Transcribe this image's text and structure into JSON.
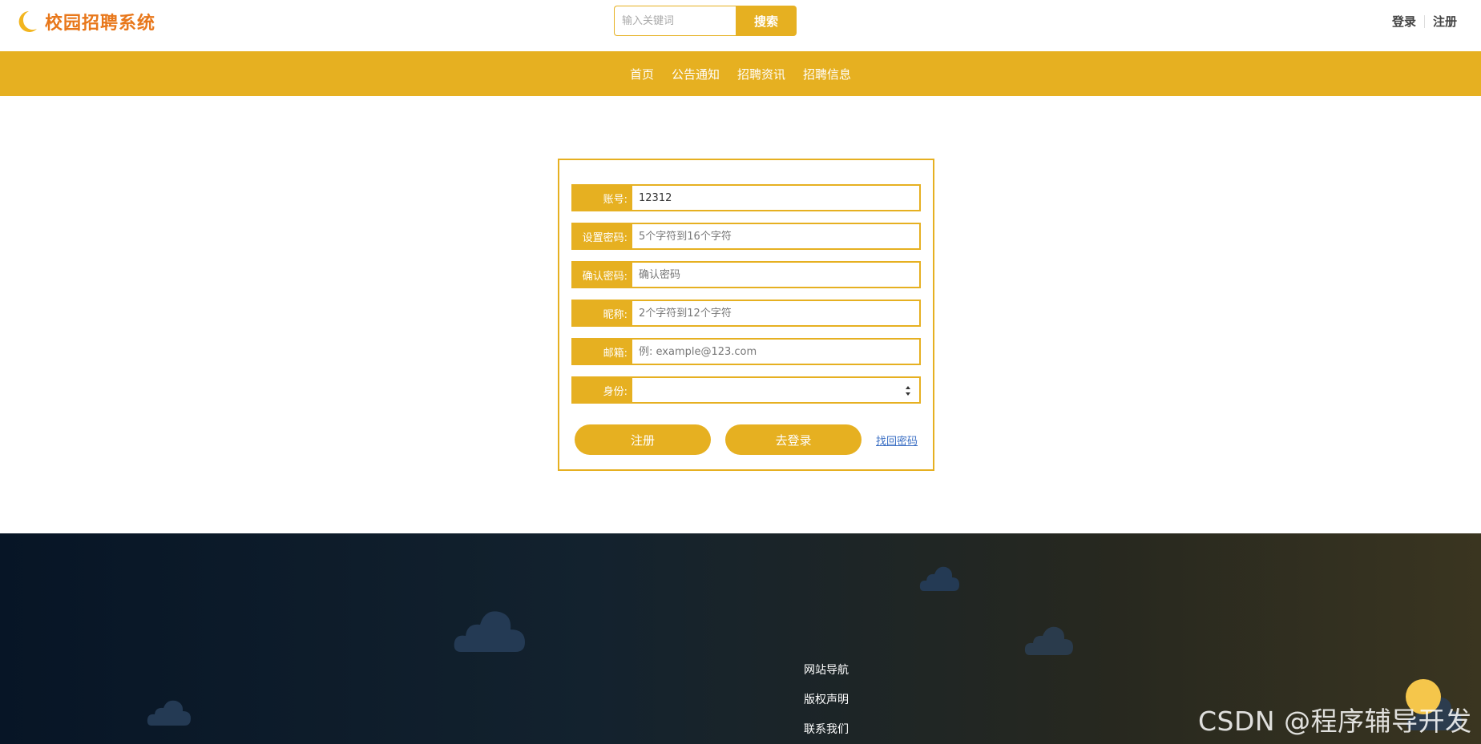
{
  "header": {
    "logo_text": "校园招聘系统",
    "search_placeholder": "输入关键词",
    "search_button": "搜索",
    "login": "登录",
    "register": "注册"
  },
  "nav": {
    "items": [
      "首页",
      "公告通知",
      "招聘资讯",
      "招聘信息"
    ]
  },
  "form": {
    "fields": [
      {
        "label": "账号:",
        "value": "12312",
        "placeholder": ""
      },
      {
        "label": "设置密码:",
        "value": "",
        "placeholder": "5个字符到16个字符"
      },
      {
        "label": "确认密码:",
        "value": "",
        "placeholder": "确认密码"
      },
      {
        "label": "昵称:",
        "value": "",
        "placeholder": "2个字符到12个字符"
      },
      {
        "label": "邮箱:",
        "value": "",
        "placeholder": "例: example@123.com"
      },
      {
        "label": "身份:",
        "value": ""
      }
    ],
    "register_button": "注册",
    "login_button": "去登录",
    "forgot_link": "找回密码"
  },
  "footer": {
    "links": [
      "网站导航",
      "版权声明",
      "联系我们"
    ]
  },
  "watermark": "CSDN @程序辅导开发",
  "colors": {
    "accent": "#e6b021",
    "logo": "#e8771a",
    "link": "#3b6fc4"
  }
}
